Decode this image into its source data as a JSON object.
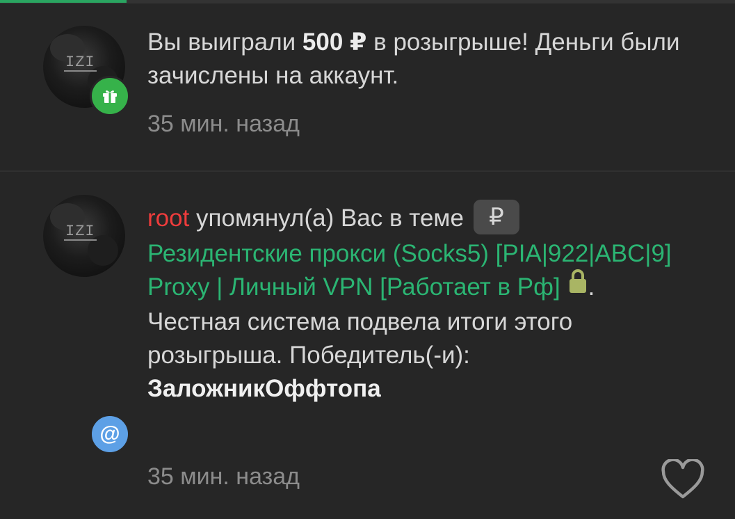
{
  "notifications": [
    {
      "type": "prize",
      "text_before": "Вы выиграли ",
      "amount": "500 ₽",
      "text_after": " в розыгрыше! Деньги были зачислены на аккаунт.",
      "time": "35 мин. назад",
      "badge_icon": "gift-icon",
      "badge_color": "#36b24a"
    },
    {
      "type": "mention",
      "username": "root",
      "mention_text": " упомянул(а) Вас в теме",
      "prefix": "₽",
      "thread_title": "Резидентские прокси (Socks5) [PIA|922|ABC|9] Proxy | Личный VPN [Работает в Рф]",
      "thread_icon": "lock-icon",
      "period": ".",
      "body_text": "Честная система подвела итоги этого розыгрыша. Победитель(-и):",
      "winner": "ЗаложникОффтопа",
      "time": "35 мин. назад",
      "badge_icon": "at-icon",
      "badge_symbol": "@",
      "badge_color": "#5da0e6",
      "action_icon": "heart-icon"
    }
  ],
  "colors": {
    "background": "#262626",
    "accent": "#2aa561",
    "username": "#ee3c3c",
    "link": "#2bb573",
    "lock": "#a9b564"
  }
}
